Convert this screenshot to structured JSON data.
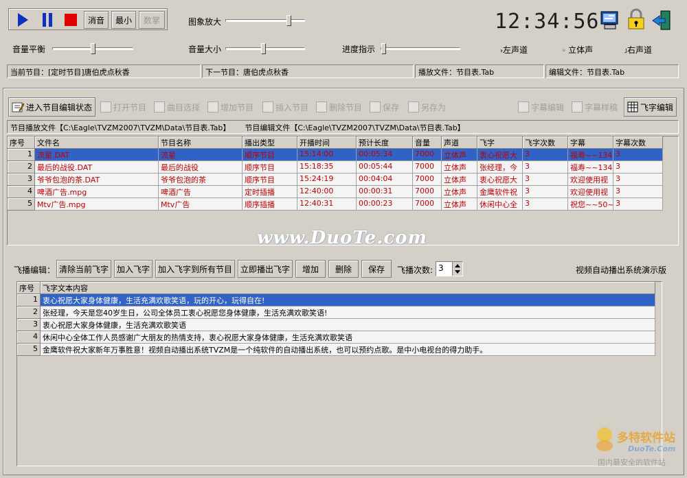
{
  "transport": {
    "mute_label": "消音",
    "min_label": "最小",
    "count_label": "数掌",
    "zoom_label": "图象放大",
    "zoom_level": 0.82
  },
  "clock": "12:34:56",
  "controls": {
    "balance_label": "音量平衡",
    "balance_level": 0.5,
    "volume_label": "音量大小",
    "volume_level": 0.48,
    "progress_label": "进度指示",
    "progress_level": 0.0,
    "left_channel": "左声道",
    "stereo": "立体声",
    "right_channel": "右声道"
  },
  "status": {
    "current": "当前节目：[定时节目]唐伯虎点秋香",
    "next": "下一节目：唐伯虎点秋香",
    "play_file": "播放文件：节目表.Tab",
    "edit_file": "编辑文件：节目表.Tab"
  },
  "toolbar": {
    "enter_edit": "进入节目编辑状态",
    "open": "打开节目",
    "song_select": "曲目选择",
    "add": "增加节目",
    "insert": "插入节目",
    "delete": "删除节目",
    "save": "保存",
    "save_as": "另存为",
    "subtitle_edit": "字幕编辑",
    "subtitle_style": "字幕样稿",
    "flyword_edit": "飞字编辑"
  },
  "files": {
    "play": "节目播放文件【C:\\Eagle\\TVZM2007\\TVZM\\Data\\节目表.Tab】",
    "edit": "节目编辑文件【C:\\Eagle\\TVZM2007\\TVZM\\Data\\节目表.Tab】"
  },
  "program_table": {
    "headers": [
      "序号",
      "文件名",
      "节目名称",
      "播出类型",
      "开播时间",
      "预计长度",
      "音量",
      "声道",
      "飞字",
      "飞字次数",
      "字幕",
      "字幕次数"
    ],
    "rows": [
      [
        "1",
        "流星.DAT",
        "流星",
        "顺序节目",
        "15:14:00",
        "00:05:34",
        "7000",
        "立体声",
        "衷心祝愿大",
        "3",
        "福寿~~134~",
        "3"
      ],
      [
        "2",
        "最后的战役.DAT",
        "最后的战役",
        "顺序节目",
        "15:18:35",
        "00:05:44",
        "7000",
        "立体声",
        "张经理，今",
        "3",
        "福寿~~134~",
        "3"
      ],
      [
        "3",
        "爷爷包泡的茶.DAT",
        "爷爷包泡的茶",
        "顺序节目",
        "15:24:19",
        "00:04:04",
        "7000",
        "立体声",
        "衷心祝愿大",
        "3",
        "欢迎使用视",
        "3"
      ],
      [
        "4",
        "啤酒广告.mpg",
        "啤酒广告",
        "定时插播",
        "12:40:00",
        "00:00:31",
        "7000",
        "立体声",
        "金鹰软件祝",
        "3",
        "欢迎使用视",
        "3"
      ],
      [
        "5",
        "Mtv广告.mpg",
        "Mtv广告",
        "顺序插播",
        "12:40:31",
        "00:00:23",
        "7000",
        "立体声",
        "休闲中心全",
        "3",
        "祝您~~50~",
        "3"
      ]
    ]
  },
  "flyword": {
    "label": "飞播编辑：",
    "clear": "清除当前飞字",
    "add": "加入飞字",
    "add_all": "加入飞字到所有节目",
    "play_now": "立即播出飞字",
    "increase": "增加",
    "delete": "删除",
    "save": "保存",
    "count_label": "飞播次数:",
    "count_value": "3",
    "edition": "视频自动播出系统演示版"
  },
  "flyword_table": {
    "headers": [
      "序号",
      "飞字文本内容"
    ],
    "rows": [
      [
        "1",
        "衷心祝愿大家身体健康，生活充满欢歌笑语，玩的开心，玩得自在!"
      ],
      [
        "2",
        "张经理，今天是您40岁生日，公司全体员工衷心祝愿您身体健康，生活充满欢歌笑语!"
      ],
      [
        "3",
        "衷心祝愿大家身体健康，生活充满欢歌笑语"
      ],
      [
        "4",
        "休闲中心全体工作人员感谢广大朋友的热情支持，衷心祝愿大家身体健康，生活充满欢歌笑语"
      ],
      [
        "5",
        "金鹰软件祝大家新年万事胜意！视频自动播出系统TVZM是一个纯软件的自动播出系统，也可以预约点歌。是中小电视台的得力助手。"
      ]
    ]
  },
  "watermark": {
    "center": "www.DuoTe.com",
    "logo": "多特软件站",
    "logo_sub": "DuoTe.Com",
    "tagline": "国内最安全的软件站"
  },
  "colors": {
    "selection": "#3162c5",
    "accent_red": "#c00000"
  }
}
